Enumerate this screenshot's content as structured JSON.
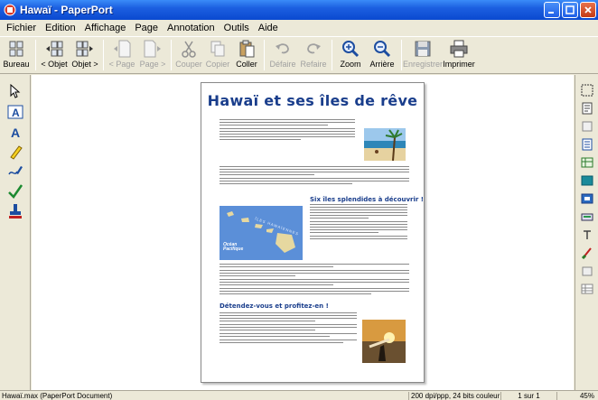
{
  "window": {
    "title": "Hawaï - PaperPort"
  },
  "menu": [
    "Fichier",
    "Edition",
    "Affichage",
    "Page",
    "Annotation",
    "Outils",
    "Aide"
  ],
  "toolbar": {
    "bureau": "Bureau",
    "prev_object": "< Objet",
    "next_object": "Objet >",
    "prev_page": "< Page",
    "next_page": "Page >",
    "cut": "Couper",
    "copy": "Copier",
    "paste": "Coller",
    "undo": "Défaire",
    "redo": "Refaire",
    "zoom": "Zoom",
    "back": "Arrière",
    "save": "Enregistrer",
    "print": "Imprimer"
  },
  "document": {
    "title": "Hawaï et ses îles de rêve",
    "heading1": "Six îles splendides à découvrir !",
    "heading2": "Détendez-vous et profitez-en !",
    "map_label_islands": "ÎLES HAWAÏENNES",
    "map_label_ocean": "Océan\nPacifique"
  },
  "status": {
    "filename": "Hawaï.max (PaperPort Document)",
    "resolution": "200 dpi/ppp, 24 bits couleur",
    "page": "1 sur 1",
    "zoom": "45%"
  }
}
